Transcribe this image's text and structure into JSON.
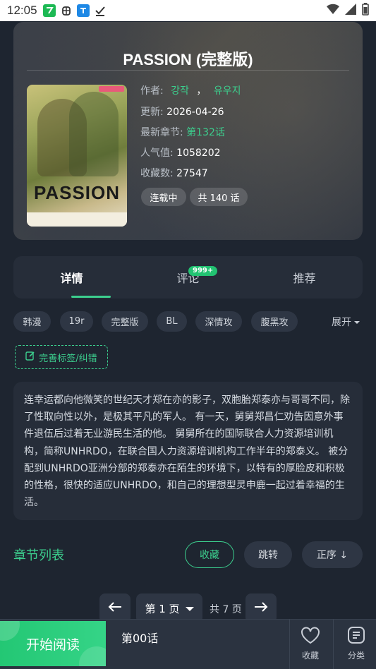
{
  "status_bar": {
    "time": "12:05"
  },
  "book": {
    "title": "PASSION (完整版)",
    "cover_title": "PASSION",
    "author_label": "作者:",
    "authors": [
      "강작",
      "유우지"
    ],
    "author_sep": "，",
    "update_label": "更新:",
    "update_date": "2026-04-26",
    "latest_label": "最新章节:",
    "latest_chapter": "第132话",
    "popularity_label": "人气值:",
    "popularity": "1058202",
    "favorites_label": "收藏数:",
    "favorites": "27547",
    "status_pill": "连载中",
    "chapters_pill": "共 140 话"
  },
  "tabs": [
    {
      "label": "详情",
      "active": true
    },
    {
      "label": "评论",
      "badge": "999+"
    },
    {
      "label": "推荐"
    }
  ],
  "tags": [
    "韩漫",
    "19r",
    "完整版",
    "BL",
    "深情攻",
    "腹黑攻"
  ],
  "expand_label": "展开",
  "edit_tags_label": "完善标签/纠错",
  "description": "连幸运都向他微笑的世纪天才郑在亦的影子，双胞胎郑泰亦与哥哥不同，除了性取向性以外，是极其平凡的军人。 有一天，舅舅郑昌仁劝告因意外事件退伍后过着无业游民生活的他。 舅舅所在的国际联合人力资源培训机构，简称UNHRDO，在联合国人力资源培训机构工作半年的郑泰义。 被分配到UNHRDO亚洲分部的郑泰亦在陌生的环境下，以特有的厚脸皮和积极的性格，很快的适应UNHRDO，和自己的理想型灵申鹿一起过着幸福的生活。",
  "chapter_list": {
    "title": "章节列表",
    "favorite_button": "收藏",
    "jump_button": "跳转",
    "order_button": "正序 ↓"
  },
  "pagination": {
    "current_page": "第 1 页",
    "total_pages": "共 7 页"
  },
  "bottom_bar": {
    "read_button": "开始阅读",
    "last_chapter": "第00话",
    "favorite_label": "收藏",
    "category_label": "分类"
  },
  "colors": {
    "accent": "#3ccf8e",
    "background": "#1e2530",
    "card": "#262d39"
  }
}
